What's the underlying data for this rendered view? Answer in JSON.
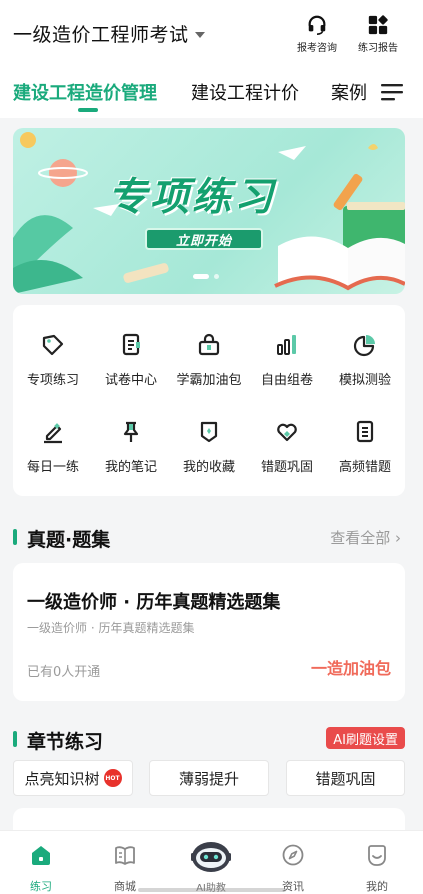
{
  "header": {
    "exam_title": "一级造价工程师考试",
    "actions": [
      {
        "label": "报考咨询",
        "icon": "headset-icon"
      },
      {
        "label": "练习报告",
        "icon": "report-grid-icon"
      }
    ]
  },
  "tabs": [
    {
      "label": "建设工程造价管理",
      "active": true
    },
    {
      "label": "建设工程计价",
      "active": false
    },
    {
      "label": "案例",
      "active": false
    }
  ],
  "banner": {
    "title": "专项练习",
    "cta": "立即开始",
    "slide_count": 2,
    "active_slide": 1
  },
  "features": [
    {
      "label": "专项练习",
      "icon": "tag-icon"
    },
    {
      "label": "试卷中心",
      "icon": "document-icon"
    },
    {
      "label": "学霸加油包",
      "icon": "lock-bag-icon"
    },
    {
      "label": "自由组卷",
      "icon": "bar-chart-icon"
    },
    {
      "label": "模拟测验",
      "icon": "pie-chart-icon"
    },
    {
      "label": "每日一练",
      "icon": "pencil-icon"
    },
    {
      "label": "我的笔记",
      "icon": "pin-icon"
    },
    {
      "label": "我的收藏",
      "icon": "shield-icon"
    },
    {
      "label": "错题巩固",
      "icon": "heart-icon"
    },
    {
      "label": "高频错题",
      "icon": "list-doc-icon"
    }
  ],
  "question_sets": {
    "title": "真题·题集",
    "see_all": "查看全部 ›",
    "card": {
      "title": "一级造价师 · 历年真题精选题集",
      "subtitle": "一级造价师 · 历年真题精选题集",
      "count_text": "已有0人开通",
      "action": "一造加油包"
    }
  },
  "chapter": {
    "title": "章节练习",
    "ai_settings": "AI刷题设置",
    "chips": [
      {
        "label": "点亮知识树",
        "badge": "HOT"
      },
      {
        "label": "薄弱提升"
      },
      {
        "label": "错题巩固"
      }
    ]
  },
  "nav": [
    {
      "label": "练习",
      "icon": "home-icon",
      "active": true
    },
    {
      "label": "商城",
      "icon": "book-icon",
      "active": false
    },
    {
      "label": "AI助教",
      "icon": "robot-icon",
      "active": false
    },
    {
      "label": "资讯",
      "icon": "compass-icon",
      "active": false
    },
    {
      "label": "我的",
      "icon": "smile-icon",
      "active": false
    }
  ],
  "colors": {
    "accent": "#1aaa7c",
    "red": "#e94b4b",
    "boost": "#f06a5a"
  }
}
